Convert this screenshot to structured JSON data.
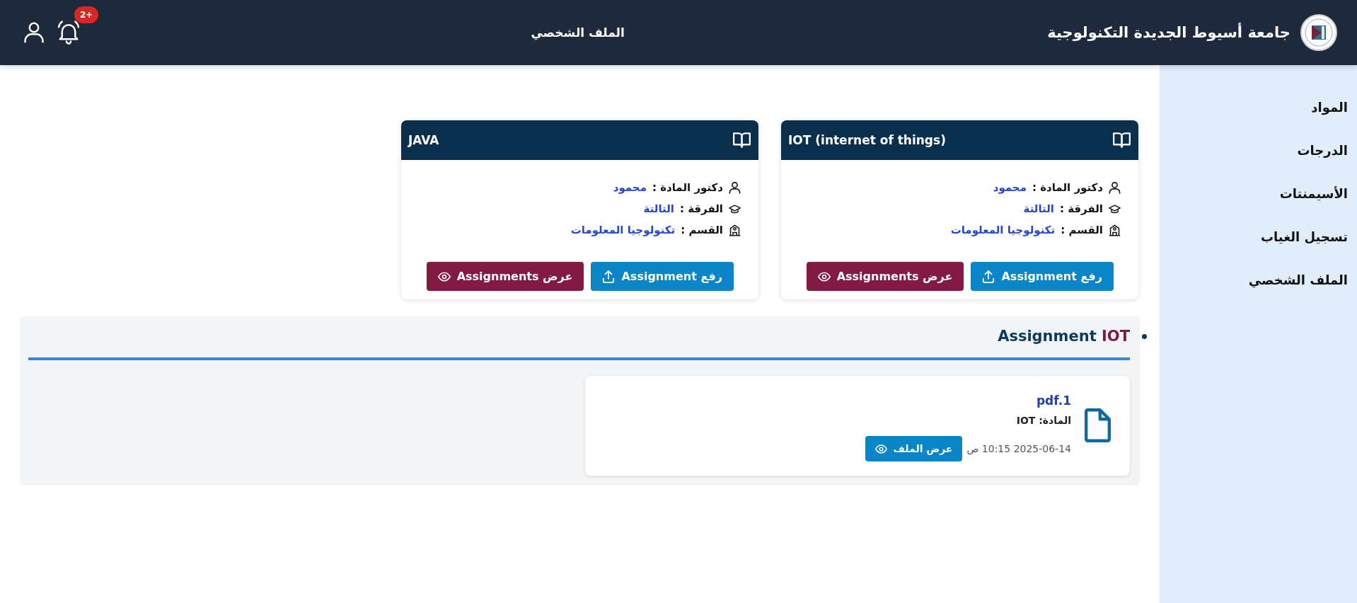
{
  "header": {
    "university_name": "جامعة أسيوط الجديدة التكنولوجية",
    "page_title": "الملف الشخصي",
    "notification_badge": "2+"
  },
  "sidebar": {
    "items": [
      {
        "label": "المواد"
      },
      {
        "label": "الدرجات"
      },
      {
        "label": "الأسيمنتات"
      },
      {
        "label": "تسجيل الغياب"
      },
      {
        "label": "الملف الشخصي"
      }
    ]
  },
  "courses": [
    {
      "title": "IOT (internet of things)",
      "fields": [
        {
          "kind": "doctor",
          "label": "دكتور المادة :",
          "value": "محمود"
        },
        {
          "kind": "year",
          "label": "الفرقة :",
          "value": "التالتة"
        },
        {
          "kind": "department",
          "label": "القسم :",
          "value": "تكنولوجيا المعلومات"
        }
      ],
      "upload_button": "رفع Assignment",
      "view_button": "عرض Assignments"
    },
    {
      "title": "JAVA",
      "fields": [
        {
          "kind": "doctor",
          "label": "دكتور المادة :",
          "value": "محمود"
        },
        {
          "kind": "year",
          "label": "الفرقة :",
          "value": "التالتة"
        },
        {
          "kind": "department",
          "label": "القسم :",
          "value": "تكنولوجيا المعلومات"
        }
      ],
      "upload_button": "رفع Assignment",
      "view_button": "عرض Assignments"
    }
  ],
  "assignments_section": {
    "title": "Assignment",
    "subject": "IOT",
    "files": [
      {
        "name": "pdf.1",
        "subject_line": "المادة: IOT",
        "date": "2025-06-14 10:15 ص",
        "view_button": "عرض الملف"
      }
    ]
  }
}
